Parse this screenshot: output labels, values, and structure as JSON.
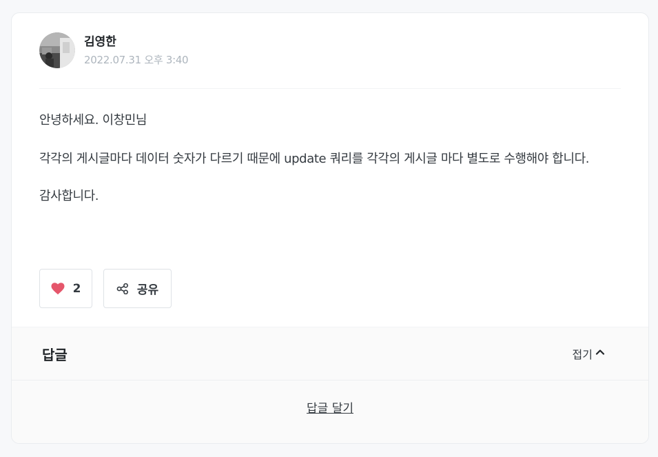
{
  "post": {
    "author_name": "김영한",
    "date": "2022.07.31 오후 3:40",
    "paragraphs": [
      "안녕하세요. 이창민님",
      "각각의 게시글마다 데이터 숫자가 다르기 때문에 update 쿼리를 각각의 게시글 마다 별도로 수행해야 합니다.",
      "감사합니다."
    ]
  },
  "actions": {
    "like_count": "2",
    "share_label": "공유"
  },
  "replies": {
    "title": "답글",
    "collapse_label": "접기",
    "write_label": "답글 달기"
  },
  "colors": {
    "heart": "#e5566b",
    "muted": "#adb5bd"
  },
  "icons": {
    "like": "heart-icon",
    "share": "share-icon",
    "collapse": "chevron-up-icon"
  }
}
